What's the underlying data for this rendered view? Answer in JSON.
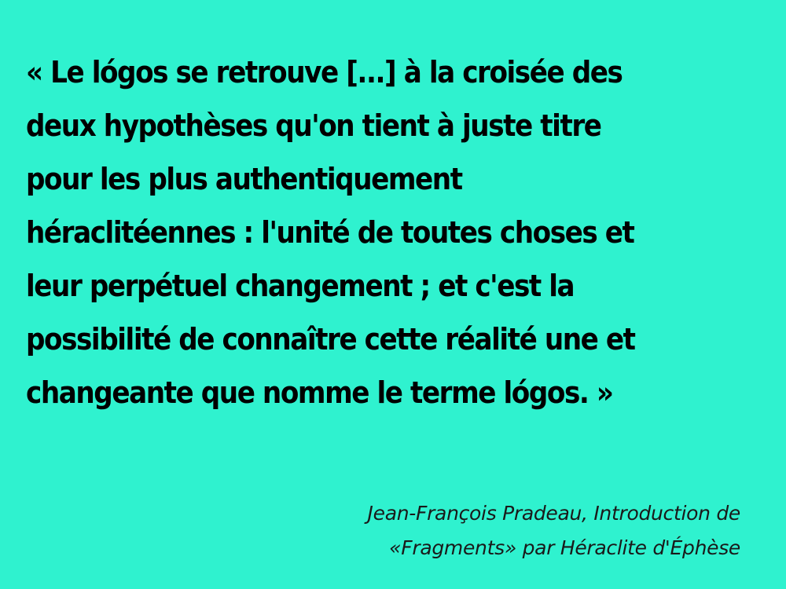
{
  "colors": {
    "background": "#2ff2cf",
    "text": "#000000"
  },
  "quote": {
    "lines": [
      "« Le lógos se retrouve [...] à la croisée des",
      "deux hypothèses qu'on tient à juste titre",
      "pour les plus authentiquement",
      "héraclitéennes : l'unité de toutes choses et",
      "leur perpétuel changement ; et c'est la",
      "possibilité de connaître cette réalité une et",
      "changeante que nomme le terme lógos. »"
    ]
  },
  "attribution": {
    "lines": [
      "Jean-François Pradeau, Introduction de",
      "«Fragments» par Héraclite d'Éphèse"
    ]
  }
}
